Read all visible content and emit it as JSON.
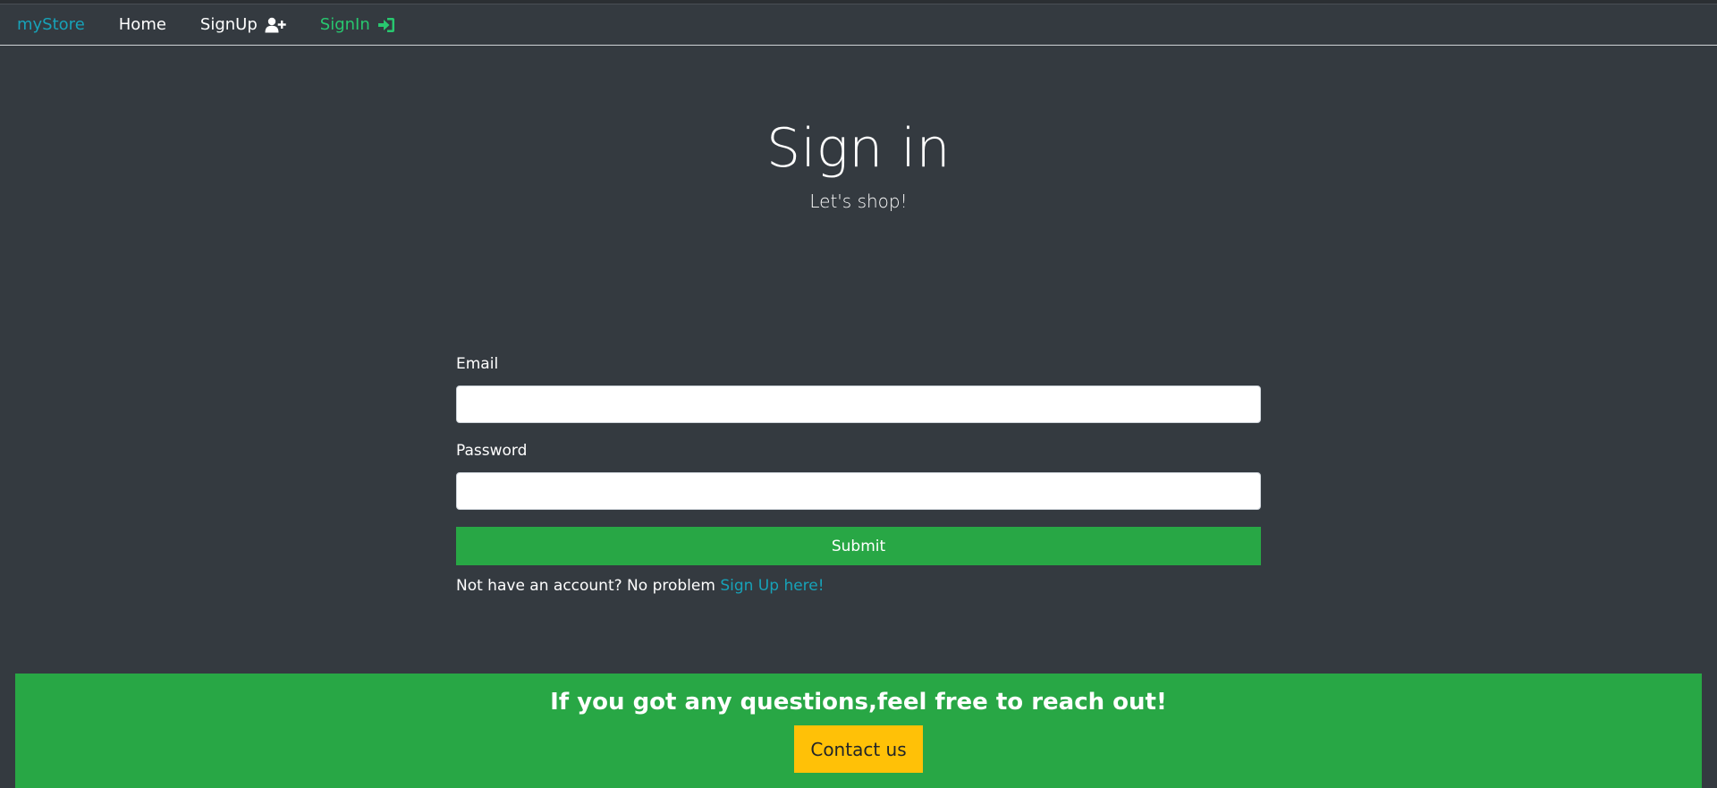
{
  "navbar": {
    "brand": "myStore",
    "home": "Home",
    "signup": "SignUp",
    "signin": "SignIn",
    "signup_icon": "user-plus-icon",
    "signin_icon": "sign-in-icon"
  },
  "hero": {
    "title": "Sign in",
    "subtitle": "Let's shop!"
  },
  "form": {
    "email_label": "Email",
    "email_value": "",
    "password_label": "Password",
    "password_value": "",
    "submit_label": "Submit",
    "hint_text": "Not have an account? No problem ",
    "hint_link": "Sign Up here!"
  },
  "footer": {
    "message": "If you got any questions,feel free to reach out!",
    "contact_label": "Contact us"
  },
  "colors": {
    "background": "#343a40",
    "brand": "#17a2b8",
    "active_nav": "#28c76f",
    "success": "#28a745",
    "warning": "#ffc107"
  }
}
